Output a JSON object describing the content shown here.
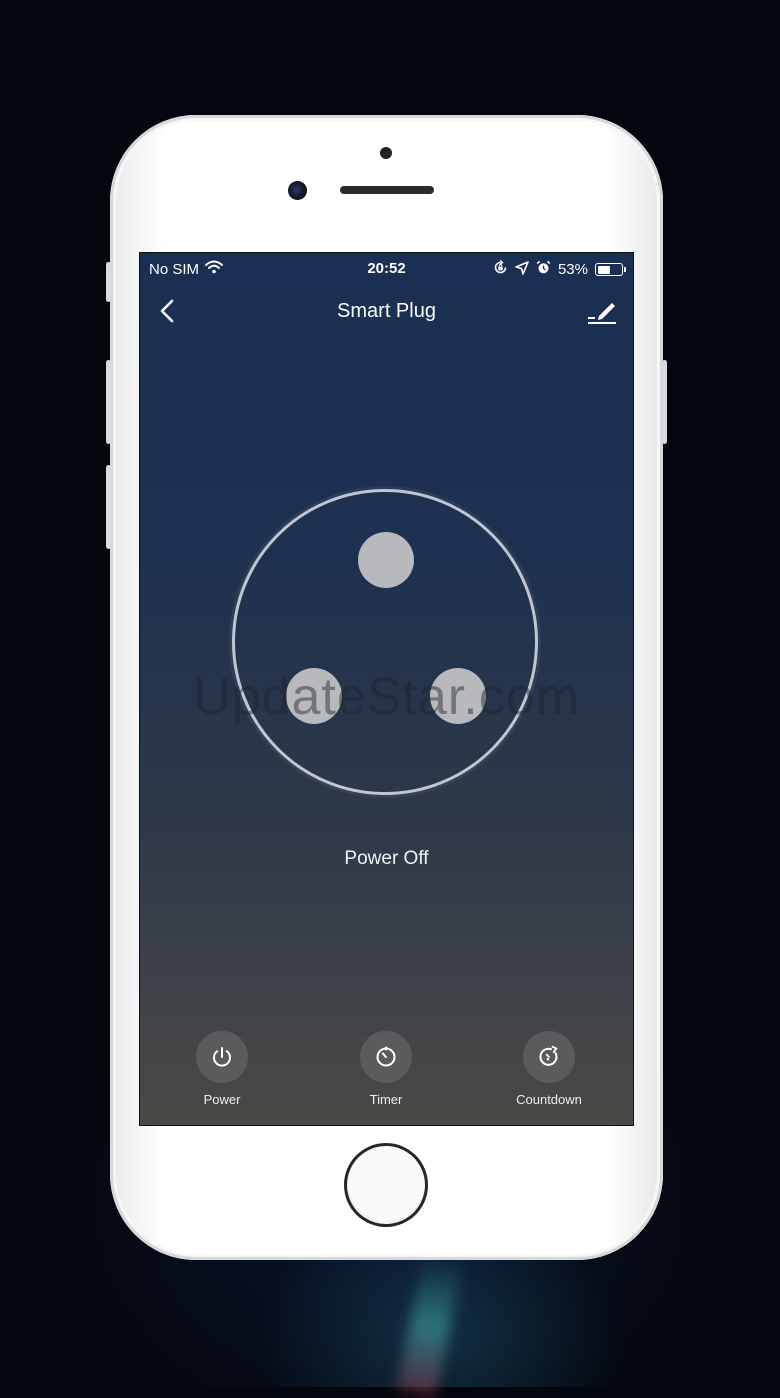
{
  "status_bar": {
    "carrier": "No SIM",
    "time": "20:52",
    "battery_percent": "53%",
    "battery_level": 0.53
  },
  "nav": {
    "title": "Smart Plug"
  },
  "device": {
    "state_label": "Power Off",
    "watermark": "UpdateStar.com"
  },
  "actions": [
    {
      "label": "Power",
      "icon": "power-icon"
    },
    {
      "label": "Timer",
      "icon": "timer-icon"
    },
    {
      "label": "Countdown",
      "icon": "countdown-icon"
    }
  ],
  "colors": {
    "screen_top": "#1a2f53",
    "screen_bottom": "#4a4844",
    "pin": "#b7b9bd"
  }
}
